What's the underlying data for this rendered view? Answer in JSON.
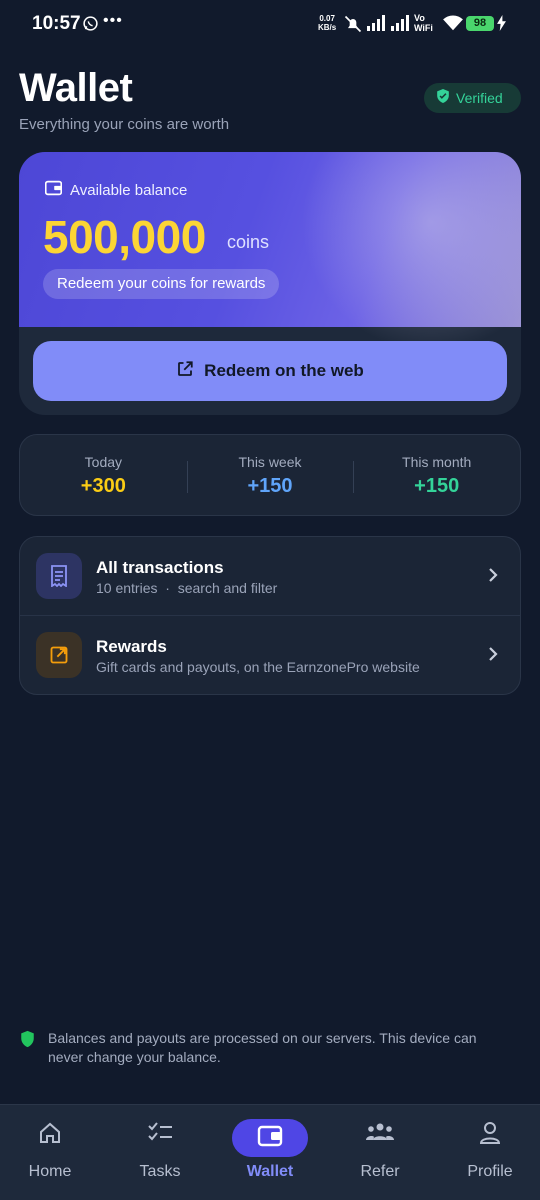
{
  "status_bar": {
    "time": "10:57",
    "network_speed_value": "0.07",
    "network_speed_unit": "KB/s",
    "vowifi_top": "Vo",
    "vowifi_bottom": "WiFi",
    "battery": "98"
  },
  "header": {
    "title": "Wallet",
    "subtitle": "Everything your coins are worth",
    "badge": "Verified"
  },
  "balance": {
    "label": "Available balance",
    "value": "500,000",
    "unit": "coins",
    "hint": "Redeem your coins for rewards",
    "web_button": "Redeem on the web"
  },
  "stats": [
    {
      "label": "Today",
      "value": "+300",
      "color": "#facc15"
    },
    {
      "label": "This week",
      "value": "+150",
      "color": "#60a5fa"
    },
    {
      "label": "This month",
      "value": "+150",
      "color": "#34d399"
    }
  ],
  "list": [
    {
      "title": "All transactions",
      "subtitle": "10 entries  ·  search and filter",
      "icon": "receipt-icon"
    },
    {
      "title": "Rewards",
      "subtitle": "Gift cards and payouts, on the EarnzonePro website",
      "icon": "external-link-icon"
    }
  ],
  "note": "Balances and payouts are processed on our servers. This device can never change your balance.",
  "nav": [
    {
      "label": "Home",
      "icon": "home-icon",
      "active": false
    },
    {
      "label": "Tasks",
      "icon": "tasks-icon",
      "active": false
    },
    {
      "label": "Wallet",
      "icon": "wallet-icon",
      "active": true
    },
    {
      "label": "Refer",
      "icon": "people-icon",
      "active": false
    },
    {
      "label": "Profile",
      "icon": "person-icon",
      "active": false
    }
  ],
  "colors": {
    "background": "#111a2c",
    "accent": "#818cf8",
    "balance": "#fcd535",
    "verified": "#34d399"
  }
}
